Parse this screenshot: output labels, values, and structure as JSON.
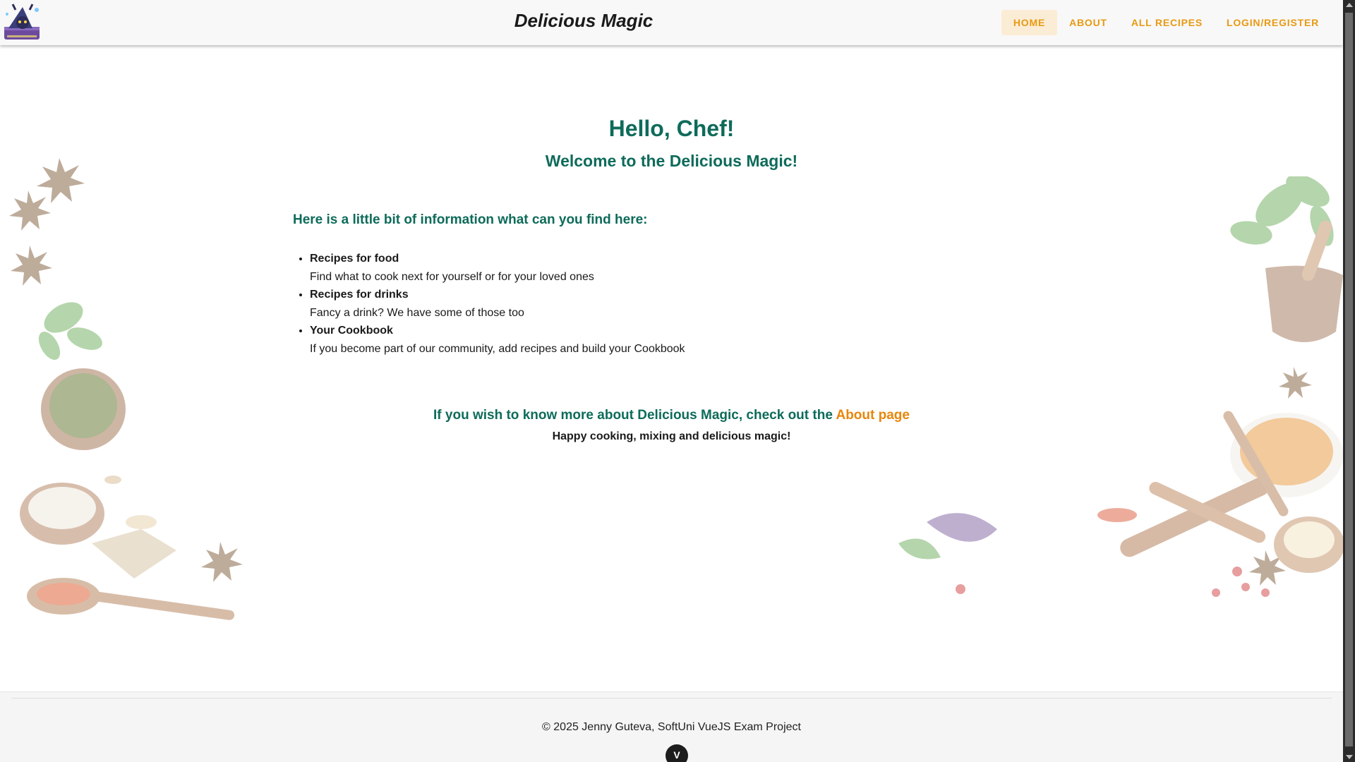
{
  "header": {
    "title": "Delicious Magic",
    "nav": [
      {
        "label": "HOME",
        "active": true
      },
      {
        "label": "ABOUT",
        "active": false
      },
      {
        "label": "ALL RECIPES",
        "active": false
      },
      {
        "label": "LOGIN/REGISTER",
        "active": false
      }
    ]
  },
  "main": {
    "hero_title": "Hello, Chef!",
    "hero_subtitle": "Welcome to the Delicious Magic!",
    "info_heading": "Here is a little bit of information what can you find here:",
    "features": [
      {
        "title": "Recipes for food",
        "description": "Find what to cook next for yourself or for your loved ones"
      },
      {
        "title": "Recipes for drinks",
        "description": "Fancy a drink? We have some of those too"
      },
      {
        "title": "Your Cookbook",
        "description": "If you become part of our community, add recipes and build your Cookbook"
      }
    ],
    "about_prefix": "If you wish to know more about Delicious Magic, check out the ",
    "about_link": "About page",
    "closing": "Happy cooking, mixing and delicious magic!"
  },
  "footer": {
    "text": "© 2025 Jenny Guteva, SoftUni VueJS Exam Project"
  },
  "devtools_badge": "V",
  "colors": {
    "primary_green": "#0e6b5a",
    "accent_orange": "#e8860c",
    "nav_orange": "#e89a12",
    "nav_active_bg": "#fbecd6"
  },
  "icons": {
    "logo": "wizard-cookbook-logo",
    "decor_left": "spices-herbs-decoration",
    "decor_right": "spices-mortar-decoration",
    "devtools": "vue-devtools-icon"
  }
}
